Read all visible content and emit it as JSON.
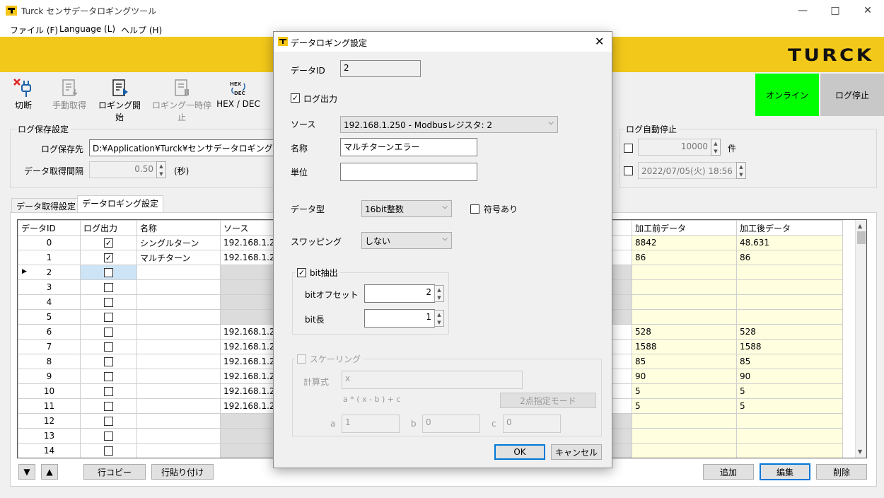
{
  "window": {
    "title": "Turck センサデータロギングツール",
    "brand_logo": "TURCK"
  },
  "menu": [
    "ファイル (F)",
    "Language (L)",
    "ヘルプ (H)"
  ],
  "toolbar": {
    "disconnect": "切断",
    "manual": "手動取得",
    "start": "ロギング開始",
    "pause": "ロギング一時停止",
    "hexdec": "HEX / DEC",
    "online": "オンライン",
    "logstop": "ログ停止"
  },
  "log_save": {
    "group_label": "ログ保存設定",
    "dest_label": "ログ保存先",
    "dest_value": "D:¥Application¥Turck¥センサデータロギングツ",
    "interval_label": "データ取得間隔",
    "interval_value": "0.50",
    "interval_unit": "(秒)"
  },
  "auto_stop": {
    "group_label": "ログ自動停止",
    "count_value": "10000",
    "count_unit": "件",
    "datetime_value": "2022/07/05(火) 18:56"
  },
  "tabs": [
    "データ取得設定",
    "データロギング設定"
  ],
  "grid": {
    "headers": [
      "データID",
      "ログ出力",
      "名称",
      "ソース",
      "加工前データ",
      "加工後データ"
    ],
    "rows": [
      {
        "id": "0",
        "checked": true,
        "name": "シングルターン",
        "source": "192.168.1.25",
        "raw": "8842",
        "processed": "48.631"
      },
      {
        "id": "1",
        "checked": true,
        "name": "マルチターン",
        "source": "192.168.1.25",
        "raw": "86",
        "processed": "86"
      },
      {
        "id": "2",
        "checked": false,
        "name": "",
        "source": "",
        "raw": "",
        "processed": ""
      },
      {
        "id": "3",
        "checked": false,
        "name": "",
        "source": "",
        "raw": "",
        "processed": ""
      },
      {
        "id": "4",
        "checked": false,
        "name": "",
        "source": "",
        "raw": "",
        "processed": ""
      },
      {
        "id": "5",
        "checked": false,
        "name": "",
        "source": "",
        "raw": "",
        "processed": ""
      },
      {
        "id": "6",
        "checked": false,
        "name": "",
        "source": "192.168.1.24",
        "raw": "528",
        "processed": "528"
      },
      {
        "id": "7",
        "checked": false,
        "name": "",
        "source": "192.168.1.24",
        "raw": "1588",
        "processed": "1588"
      },
      {
        "id": "8",
        "checked": false,
        "name": "",
        "source": "192.168.1.24",
        "raw": "85",
        "processed": "85"
      },
      {
        "id": "9",
        "checked": false,
        "name": "",
        "source": "192.168.1.24",
        "raw": "90",
        "processed": "90"
      },
      {
        "id": "10",
        "checked": false,
        "name": "",
        "source": "192.168.1.24",
        "raw": "5",
        "processed": "5"
      },
      {
        "id": "11",
        "checked": false,
        "name": "",
        "source": "192.168.1.24",
        "raw": "5",
        "processed": "5"
      },
      {
        "id": "12",
        "checked": false,
        "name": "",
        "source": "",
        "raw": "",
        "processed": ""
      },
      {
        "id": "13",
        "checked": false,
        "name": "",
        "source": "",
        "raw": "",
        "processed": ""
      },
      {
        "id": "14",
        "checked": false,
        "name": "",
        "source": "",
        "raw": "",
        "processed": ""
      }
    ]
  },
  "bottom": {
    "down": "▼",
    "up": "▲",
    "copy_row": "行コピー",
    "paste_row": "行貼り付け",
    "add": "追加",
    "edit": "編集",
    "delete": "削除"
  },
  "dialog": {
    "title": "データロギング設定",
    "data_id_label": "データID",
    "data_id_value": "2",
    "log_output_label": "ログ出力",
    "source_label": "ソース",
    "source_value": "192.168.1.250 - Modbusレジスタ: 2",
    "name_label": "名称",
    "name_value": "マルチターンエラー",
    "unit_label": "単位",
    "unit_value": "",
    "datatype_label": "データ型",
    "datatype_value": "16bit整数",
    "signed_label": "符号あり",
    "swap_label": "スワッピング",
    "swap_value": "しない",
    "bit_extract_label": "bit抽出",
    "bit_offset_label": "bitオフセット",
    "bit_offset_value": "2",
    "bit_length_label": "bit長",
    "bit_length_value": "1",
    "scaling_label": "スケーリング",
    "formula_label": "計算式",
    "formula_value": "x",
    "formula_hint": "a * ( x - b ) + c",
    "two_point_mode": "2点指定モード",
    "a_label": "a",
    "a_value": "1",
    "b_label": "b",
    "b_value": "0",
    "c_label": "c",
    "c_value": "0",
    "ok": "OK",
    "cancel": "キャンセル"
  },
  "colors": {
    "brand_yellow": "#f2c81a",
    "online_green": "#00ff00",
    "cell_yellow": "#ffffe0",
    "selection_blue": "#cde4f7"
  }
}
